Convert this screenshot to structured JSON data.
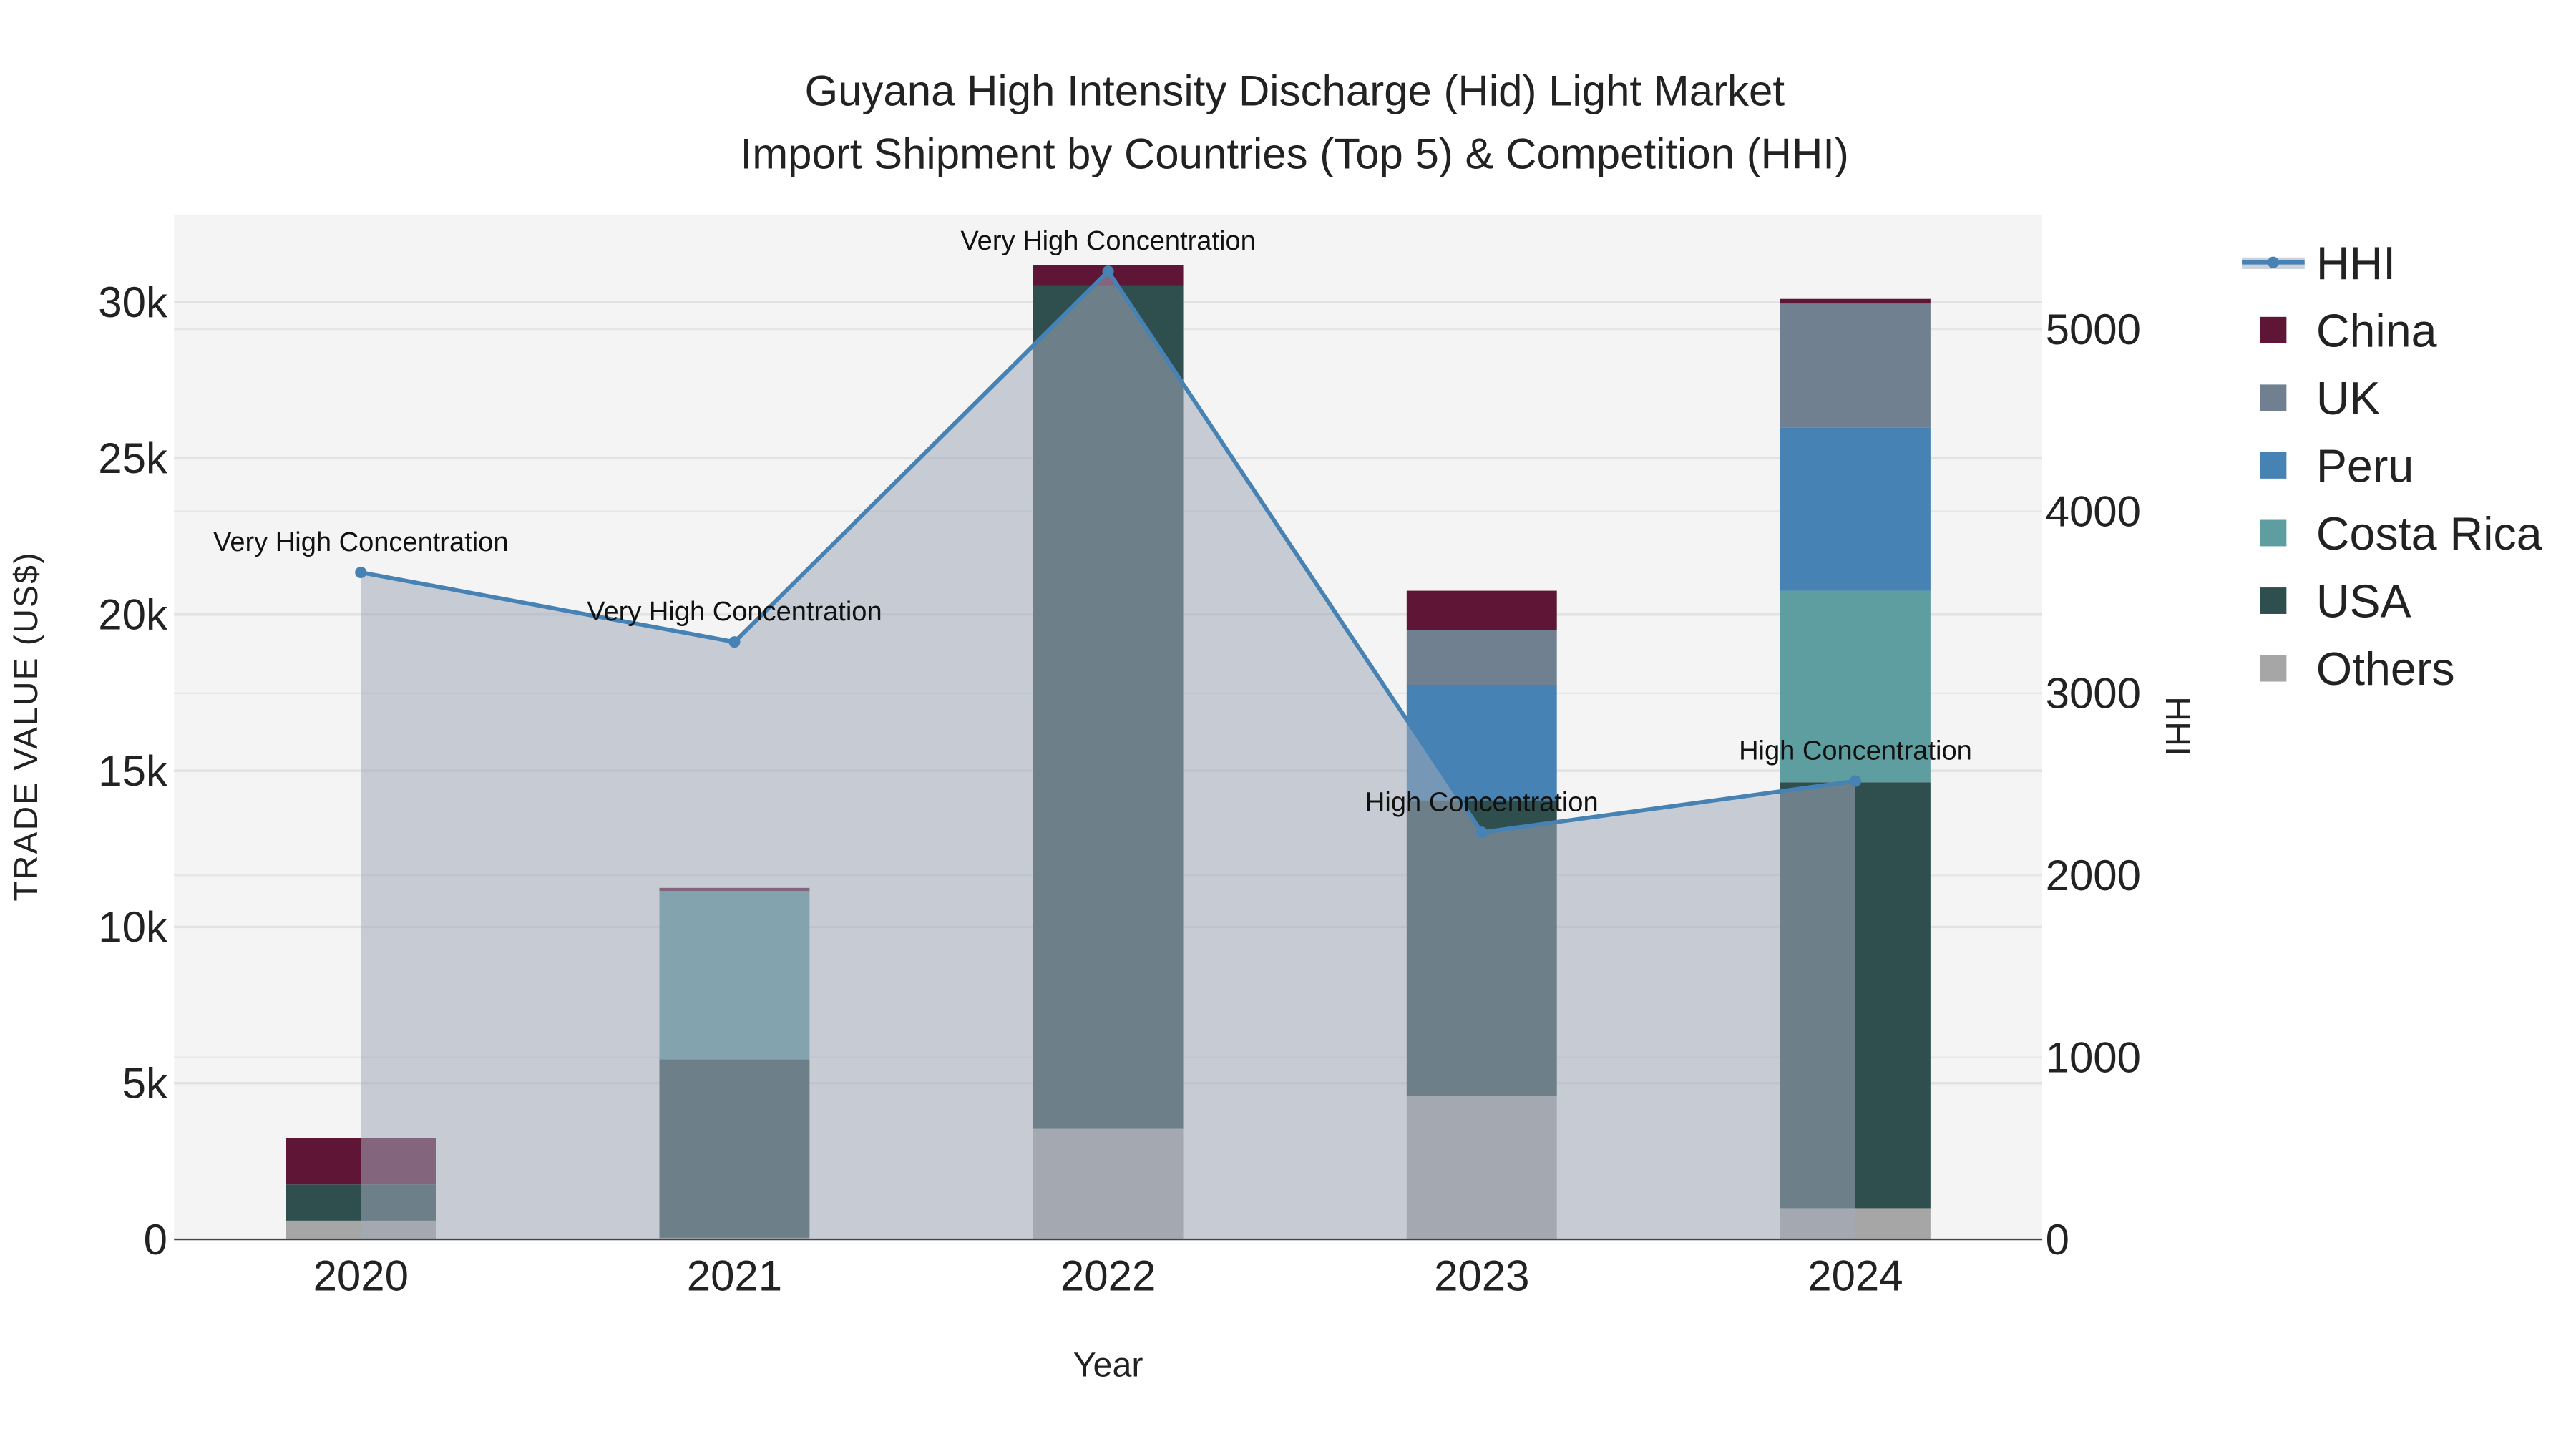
{
  "chart_data": {
    "type": "bar",
    "title_line1": "Guyana High Intensity Discharge (Hid) Light Market",
    "title_line2": "Import Shipment by Countries (Top 5) & Competition (HHI)",
    "xlabel": "Year",
    "ylabel": "TRADE VALUE (US$)",
    "y2label": "HHI",
    "categories": [
      "2020",
      "2021",
      "2022",
      "2023",
      "2024"
    ],
    "ylim": [
      0,
      32800
    ],
    "y_ticks": [
      0,
      5000,
      10000,
      15000,
      20000,
      25000,
      30000
    ],
    "y_tick_labels": [
      "0",
      "5k",
      "10k",
      "15k",
      "20k",
      "25k",
      "30k"
    ],
    "y2lim": [
      0,
      5630
    ],
    "y2_ticks": [
      0,
      1000,
      2000,
      3000,
      4000,
      5000
    ],
    "y2_tick_labels": [
      "0",
      "1000",
      "2000",
      "3000",
      "4000",
      "5000"
    ],
    "grid": true,
    "legend_placement": "right",
    "series": [
      {
        "name": "Others",
        "color": "#a6a6a6",
        "values": [
          600,
          50,
          3540,
          4600,
          1000
        ]
      },
      {
        "name": "USA",
        "color": "#2f4f4f",
        "values": [
          1160,
          5710,
          26990,
          9450,
          13630
        ]
      },
      {
        "name": "Costa Rica",
        "color": "#5f9ea0",
        "values": [
          0,
          5390,
          0,
          0,
          6130
        ]
      },
      {
        "name": "Peru",
        "color": "#4682b4",
        "values": [
          0,
          0,
          0,
          3700,
          5230
        ]
      },
      {
        "name": "UK",
        "color": "#708090",
        "values": [
          0,
          0,
          0,
          1750,
          3960
        ]
      },
      {
        "name": "China",
        "color": "#5f1535",
        "values": [
          1480,
          100,
          640,
          1260,
          150
        ]
      }
    ],
    "legend_order": [
      "HHI",
      "China",
      "UK",
      "Peru",
      "Costa Rica",
      "USA",
      "Others"
    ],
    "hhi": {
      "name": "HHI",
      "color": "#4682b4",
      "values": [
        3664,
        3282,
        5318,
        2236,
        2518
      ],
      "annotations": [
        "Very High Concentration",
        "Very High Concentration",
        "Very High Concentration",
        "High Concentration",
        "High Concentration"
      ]
    }
  }
}
